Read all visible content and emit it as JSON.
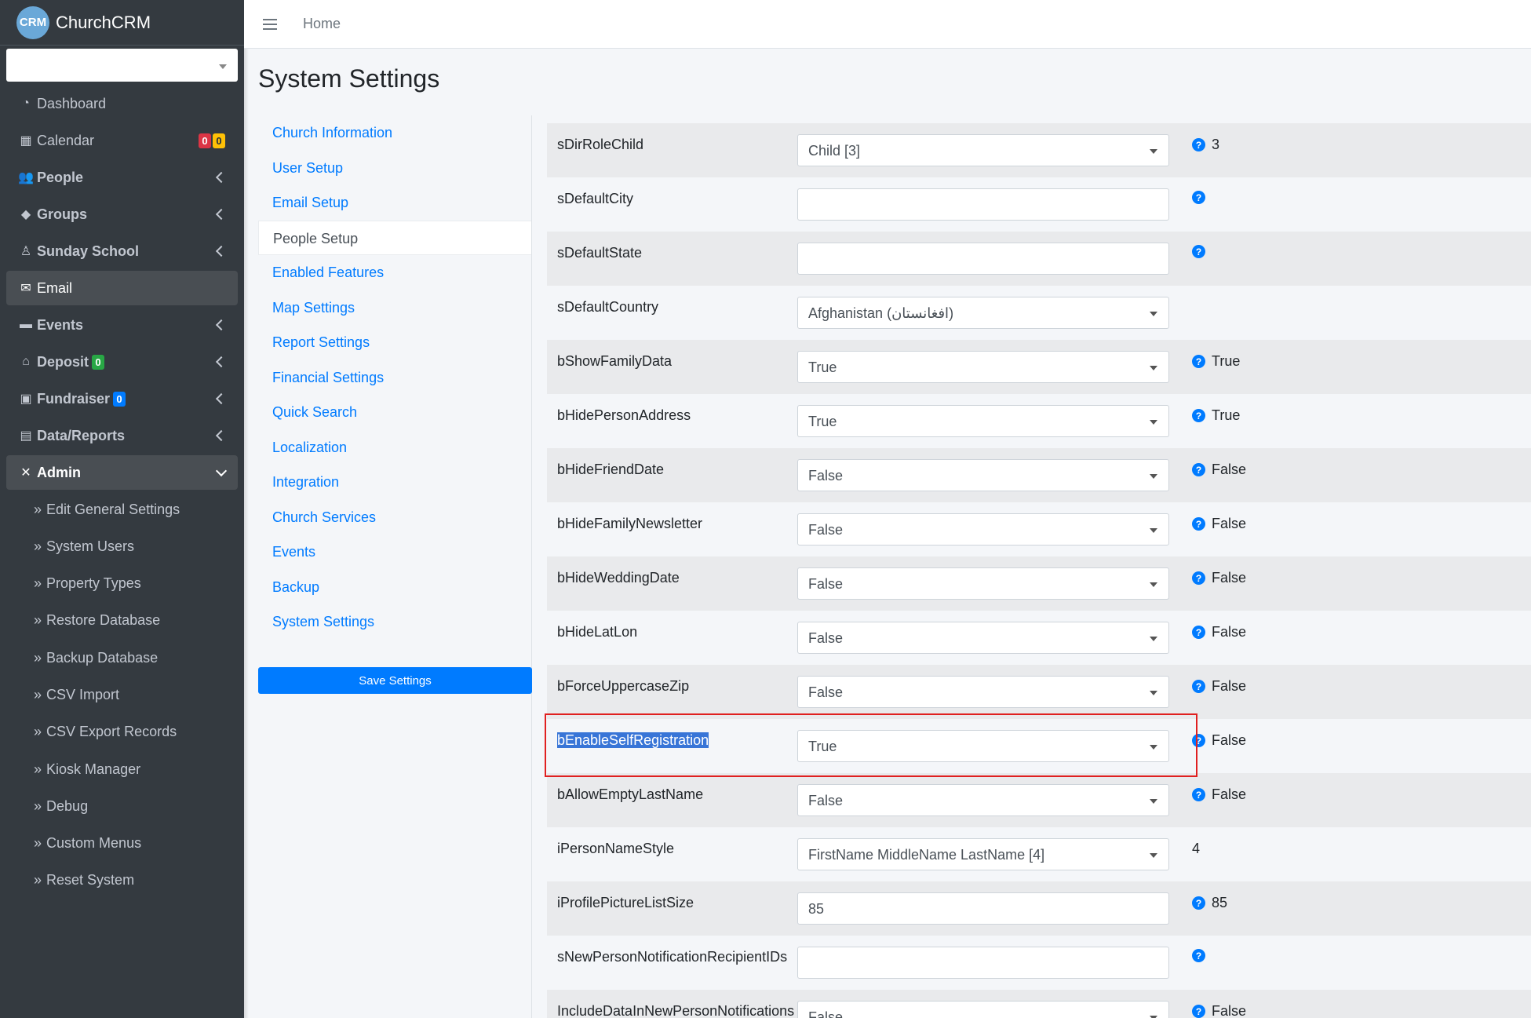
{
  "brand": {
    "logo": "CRM",
    "name": "ChurchCRM"
  },
  "sidebar": {
    "items": [
      {
        "label": "Dashboard",
        "icon": "dashboard-icon"
      },
      {
        "label": "Calendar",
        "icon": "calendar-icon",
        "badges": [
          "0",
          "0"
        ]
      },
      {
        "label": "People",
        "icon": "people-icon"
      },
      {
        "label": "Groups",
        "icon": "tag-icon"
      },
      {
        "label": "Sunday School",
        "icon": "child-icon"
      },
      {
        "label": "Email",
        "icon": "envelope-icon"
      },
      {
        "label": "Events",
        "icon": "ticket-icon"
      },
      {
        "label": "Deposit",
        "icon": "bank-icon",
        "badge": "0"
      },
      {
        "label": "Fundraiser",
        "icon": "money-icon",
        "badge": "0"
      },
      {
        "label": "Data/Reports",
        "icon": "file-pdf-icon"
      },
      {
        "label": "Admin",
        "icon": "tools-icon"
      }
    ],
    "admin_sub": [
      "Edit General Settings",
      "System Users",
      "Property Types",
      "Restore Database",
      "Backup Database",
      "CSV Import",
      "CSV Export Records",
      "Kiosk Manager",
      "Debug",
      "Custom Menus",
      "Reset System"
    ]
  },
  "topbar": {
    "home": "Home"
  },
  "page": {
    "title": "System Settings"
  },
  "settings_menu": [
    "Church Information",
    "User Setup",
    "Email Setup",
    "People Setup",
    "Enabled Features",
    "Map Settings",
    "Report Settings",
    "Financial Settings",
    "Quick Search",
    "Localization",
    "Integration",
    "Church Services",
    "Events",
    "Backup",
    "System Settings"
  ],
  "save_label": "Save Settings",
  "settings": [
    {
      "name": "sDirRoleChild",
      "value": "Child [3]",
      "type": "select",
      "help": true,
      "default": "3"
    },
    {
      "name": "sDefaultCity",
      "value": "",
      "type": "text",
      "help": true,
      "default": ""
    },
    {
      "name": "sDefaultState",
      "value": "",
      "type": "text",
      "help": true,
      "default": ""
    },
    {
      "name": "sDefaultCountry",
      "value": "Afghanistan (افغانستان)",
      "type": "select",
      "help": false,
      "default": ""
    },
    {
      "name": "bShowFamilyData",
      "value": "True",
      "type": "select",
      "help": true,
      "default": "True"
    },
    {
      "name": "bHidePersonAddress",
      "value": "True",
      "type": "select",
      "help": true,
      "default": "True"
    },
    {
      "name": "bHideFriendDate",
      "value": "False",
      "type": "select",
      "help": true,
      "default": "False"
    },
    {
      "name": "bHideFamilyNewsletter",
      "value": "False",
      "type": "select",
      "help": true,
      "default": "False"
    },
    {
      "name": "bHideWeddingDate",
      "value": "False",
      "type": "select",
      "help": true,
      "default": "False"
    },
    {
      "name": "bHideLatLon",
      "value": "False",
      "type": "select",
      "help": true,
      "default": "False"
    },
    {
      "name": "bForceUppercaseZip",
      "value": "False",
      "type": "select",
      "help": true,
      "default": "False"
    },
    {
      "name": "bEnableSelfRegistration",
      "value": "True",
      "type": "select",
      "help": true,
      "default": "False"
    },
    {
      "name": "bAllowEmptyLastName",
      "value": "False",
      "type": "select",
      "help": true,
      "default": "False"
    },
    {
      "name": "iPersonNameStyle",
      "value": "FirstName MiddleName LastName [4]",
      "type": "select",
      "help": false,
      "default": "4"
    },
    {
      "name": "iProfilePictureListSize",
      "value": "85",
      "type": "text",
      "help": true,
      "default": "85"
    },
    {
      "name": "sNewPersonNotificationRecipientIDs",
      "value": "",
      "type": "text",
      "help": true,
      "default": ""
    },
    {
      "name": "IncludeDataInNewPersonNotifications",
      "value": "False",
      "type": "select",
      "help": true,
      "default": "False"
    }
  ],
  "colors": {
    "accent": "#007bff",
    "sidebar_bg": "#343a40",
    "highlight": "#e02020"
  }
}
